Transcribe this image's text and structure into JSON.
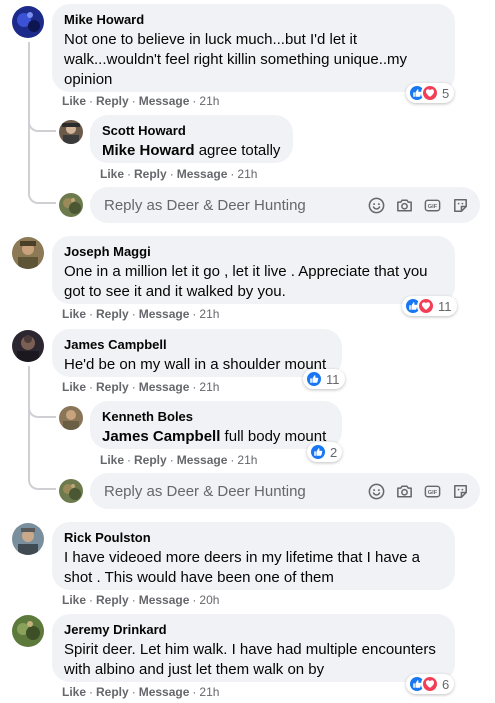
{
  "colors": {
    "like_blue": "#1877f2",
    "love_red": "#f33e58",
    "bubble_bg": "#f0f2f5",
    "meta_gray": "#65676b"
  },
  "comments": [
    {
      "author": "Mike Howard",
      "text": "Not one to believe in luck much...but I'd let it walk...wouldn't feel right killin something unique..my opinion",
      "actions": {
        "like": "Like",
        "reply": "Reply",
        "message": "Message",
        "time": "21h"
      },
      "reactions": {
        "icons": [
          "like-icon",
          "love-icon"
        ],
        "count": "5"
      },
      "replies": [
        {
          "author": "Scott Howard",
          "mention": "Mike Howard",
          "text": " agree totally",
          "actions": {
            "like": "Like",
            "reply": "Reply",
            "message": "Message",
            "time": "21h"
          }
        }
      ],
      "reply_box": {
        "placeholder": "Reply as Deer & Deer Hunting"
      }
    },
    {
      "author": "Joseph Maggi",
      "text": "One in a million let it go , let it live . Appreciate that you got to see it and it walked by you.",
      "actions": {
        "like": "Like",
        "reply": "Reply",
        "message": "Message",
        "time": "21h"
      },
      "reactions": {
        "icons": [
          "like-icon",
          "love-icon"
        ],
        "count": "11"
      }
    },
    {
      "author": "James Campbell",
      "text": "He'd be on my wall in a shoulder mount",
      "actions": {
        "like": "Like",
        "reply": "Reply",
        "message": "Message",
        "time": "21h"
      },
      "reactions": {
        "icons": [
          "like-icon"
        ],
        "count": "11"
      },
      "replies": [
        {
          "author": "Kenneth Boles",
          "mention": "James Campbell",
          "text": " full body mount",
          "actions": {
            "like": "Like",
            "reply": "Reply",
            "message": "Message",
            "time": "21h"
          },
          "reactions": {
            "icons": [
              "like-icon"
            ],
            "count": "2"
          }
        }
      ],
      "reply_box": {
        "placeholder": "Reply as Deer & Deer Hunting"
      }
    },
    {
      "author": "Rick Poulston",
      "text": "I have videoed more deers in my lifetime that I have a shot . This would have been one of them",
      "actions": {
        "like": "Like",
        "reply": "Reply",
        "message": "Message",
        "time": "20h"
      }
    },
    {
      "author": "Jeremy Drinkard",
      "text": "Spirit deer. Let him walk. I have had multiple encounters with albino and just let them walk on by",
      "actions": {
        "like": "Like",
        "reply": "Reply",
        "message": "Message",
        "time": "21h"
      },
      "reactions": {
        "icons": [
          "like-icon",
          "love-icon"
        ],
        "count": "6"
      }
    }
  ],
  "reply_tools": [
    "emoji-icon",
    "camera-icon",
    "gif-icon",
    "sticker-icon"
  ]
}
